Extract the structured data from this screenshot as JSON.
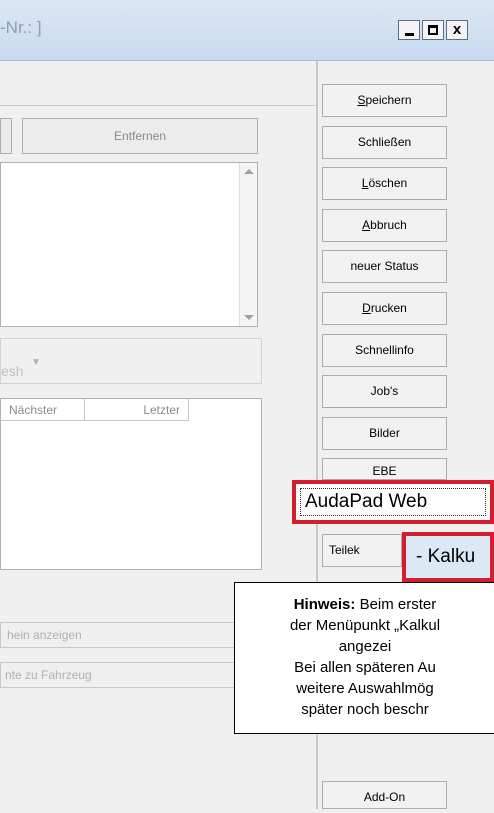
{
  "window": {
    "title_fragment": "-Nr.: ]",
    "min_label": "",
    "max_label": "",
    "close_label": "x"
  },
  "left": {
    "remove_button": "Entfernen",
    "combo_text": "esh",
    "table_headers": [
      "Nächster",
      "Letzter"
    ],
    "buttons": [
      "hein anzeigen",
      "nte zu Fahrzeug"
    ]
  },
  "sidebar": {
    "buttons": [
      {
        "label_u": "S",
        "label_rest": "peichern"
      },
      {
        "label_u": "",
        "label_rest": "Schließen"
      },
      {
        "label_u": "L",
        "label_rest": "öschen"
      },
      {
        "label_u": "A",
        "label_rest": "bbruch"
      },
      {
        "label_u": "",
        "label_rest": "neuer Status"
      },
      {
        "label_u": "D",
        "label_rest": "rucken"
      },
      {
        "label_u": "",
        "label_rest": "Schnellinfo"
      },
      {
        "label_u": "",
        "label_rest": "Job's"
      },
      {
        "label_u": "",
        "label_rest": "Bilder"
      },
      {
        "label_u": "",
        "label_rest": "EBE"
      }
    ],
    "audapad": "AudaPad Web",
    "teilek": "Teilek",
    "kalku": "- Kalku",
    "addon": "Add-On"
  },
  "note": {
    "bold": "Hinweis:",
    "line1_rest": " Beim erster",
    "line2": "der Menüpunkt „Kalkul",
    "line3": "angezei",
    "line4": "Bei allen späteren Au",
    "line5": "weitere Auswahlmög",
    "line6": "später noch beschr"
  }
}
